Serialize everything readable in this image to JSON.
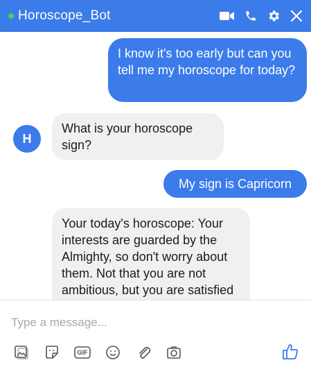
{
  "header": {
    "title": "Horoscope_Bot",
    "bg_color": "#3b7bea",
    "online_color": "#42d06a",
    "icons": [
      "video-icon",
      "phone-icon",
      "gear-icon",
      "close-icon"
    ]
  },
  "avatar": {
    "letter": "H"
  },
  "messages": [
    {
      "from": "user",
      "text": "I know it's too early but can you tell me my horoscope for today?"
    },
    {
      "from": "bot",
      "text": "What is your horoscope sign?"
    },
    {
      "from": "user",
      "text": "My sign is Capricorn"
    },
    {
      "from": "bot",
      "text": "Your today's horoscope: Your interests are guarded by the Almighty, so don't worry about them. Not that you are not ambitious, but you are satisfied with what"
    }
  ],
  "composer": {
    "placeholder": "Type a message...",
    "toolbar_icons": [
      "image-icon",
      "sticker-icon",
      "gif-icon",
      "emoji-icon",
      "attachment-icon",
      "camera-icon"
    ],
    "gif_label": "GIF",
    "like_icon": "thumbs-up-icon"
  }
}
